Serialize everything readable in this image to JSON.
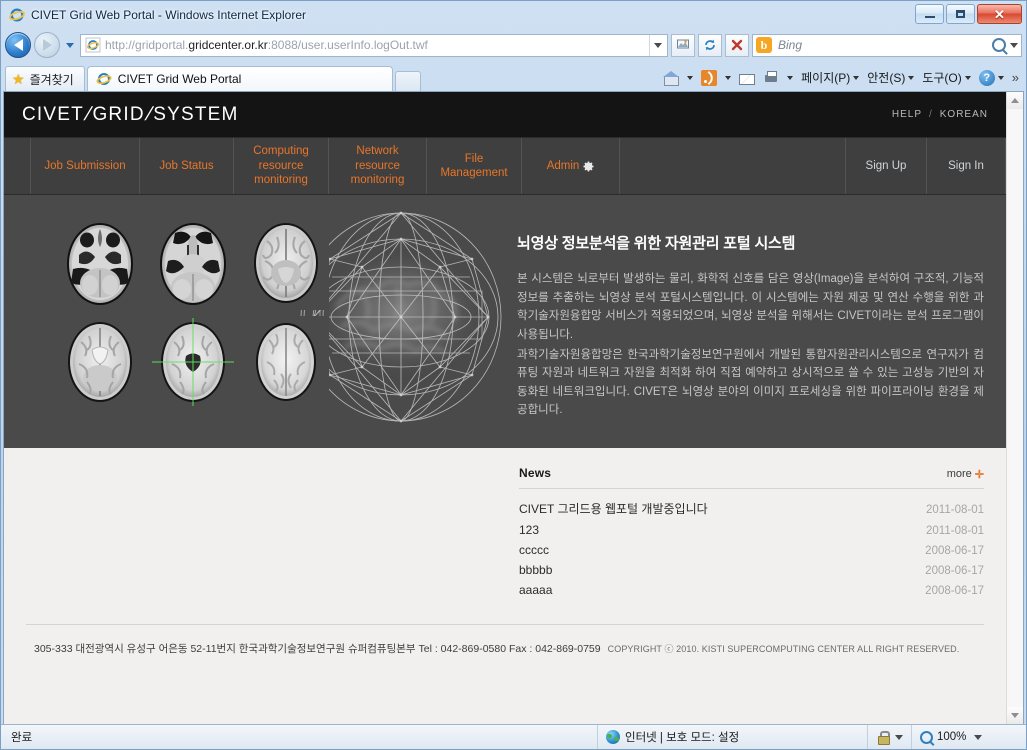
{
  "window": {
    "title": "CIVET Grid Web Portal - Windows Internet Explorer",
    "minimize_label": "",
    "maximize_label": "",
    "close_label": "✕"
  },
  "address_bar": {
    "url_prefix": "http://gridportal.",
    "url_domain": "gridcenter.or.kr",
    "url_suffix": ":8088/user.userInfo.logOut.twf",
    "search_placeholder": "Bing",
    "bing_mark": "b"
  },
  "tabs_bar": {
    "favorites_label": "즐겨찾기",
    "tabs": [
      {
        "label": "CIVET Grid Web Portal"
      }
    ],
    "command_items": [
      {
        "label": "",
        "icon": "home-icon"
      },
      {
        "label": "",
        "icon": "rss-icon"
      },
      {
        "label": "",
        "icon": "mail-icon"
      },
      {
        "label": "",
        "icon": "print-icon"
      },
      {
        "label": "페이지(P)",
        "icon": ""
      },
      {
        "label": "안전(S)",
        "icon": ""
      },
      {
        "label": "도구(O)",
        "icon": ""
      },
      {
        "label": "",
        "icon": "help-icon"
      }
    ],
    "overflow_label": "»"
  },
  "site": {
    "logo": {
      "part1": "CIVET",
      "slash1": "/",
      "part2": "GRID",
      "slash2": "/",
      "part3": "SYSTEM"
    },
    "header_links": {
      "help": "HELP",
      "separator": "/",
      "korean": "KOREAN"
    },
    "nav": [
      {
        "label": "Job Submission"
      },
      {
        "label": "Job Status"
      },
      {
        "label": "Computing\nresource\nmonitoring"
      },
      {
        "label": "Network\nresource\nmonitoring"
      },
      {
        "label": "File\nManagement"
      },
      {
        "label": "Admin"
      }
    ],
    "nav_admin_icon": "gear-icon",
    "auth": [
      {
        "label": "Sign Up"
      },
      {
        "label": "Sign In"
      }
    ],
    "hero": {
      "title": "뇌영상 정보분석을 위한 자원관리 포털 시스템",
      "paragraph1": "본 시스템은 뇌로부터 발생하는 물리, 화학적 신호를 담은 영상(Image)을 분석하여 구조적, 기능적 정보를 추출하는 뇌영상 분석 포털시스템입니다. 이 시스템에는 자원 제공 및 연산 수행을 위한 과학기술자원융합망 서비스가 적용되었으며, 뇌영상 분석을 위해서는 CIVET이라는 분석 프로그램이 사용됩니다.",
      "paragraph2": "과학기술자원융합망은 한국과학기술정보연구원에서 개발된 통합자원관리시스템으로 연구자가 컴퓨팅 자원과 네트워크 자원을 최적화 하여 직접 예약하고 상시적으로 쓸 수 있는 고성능 기반의 자동화된 네트워크입니다. CIVET은 뇌영상 분야의 이미지 프로세싱을 위한 파이프라이닝 환경을 제공합니다."
    },
    "news": {
      "title": "News",
      "more_label": "more",
      "more_plus": "✛",
      "items": [
        {
          "title": "CIVET 그리드용 웹포털 개발중입니다",
          "date": "2011-08-01"
        },
        {
          "title": "123",
          "date": "2011-08-01"
        },
        {
          "title": "ccccc",
          "date": "2008-06-17"
        },
        {
          "title": "bbbbb",
          "date": "2008-06-17"
        },
        {
          "title": "aaaaa",
          "date": "2008-06-17"
        }
      ]
    },
    "footer": {
      "address": "305-333 대전광역시 유성구 어은동 52-11번지 한국과학기술정보연구원 슈퍼컴퓨팅본부 Tel : 042-869-0580 Fax : 042-869-0759",
      "copyright": "COPYRIGHT ⓒ 2010. KISTI SUPERCOMPUTING CENTER ALL RIGHT RESERVED."
    }
  },
  "status_bar": {
    "state": "완료",
    "zone": "인터넷 | 보호 모드: 설정",
    "zoom": "100%"
  },
  "colors": {
    "accent_orange": "#e8762a",
    "header_black": "#141414",
    "nav_gray": "#3f3f3f",
    "hero_gray": "#4a4a4a",
    "page_bg": "#f1f0ee"
  }
}
